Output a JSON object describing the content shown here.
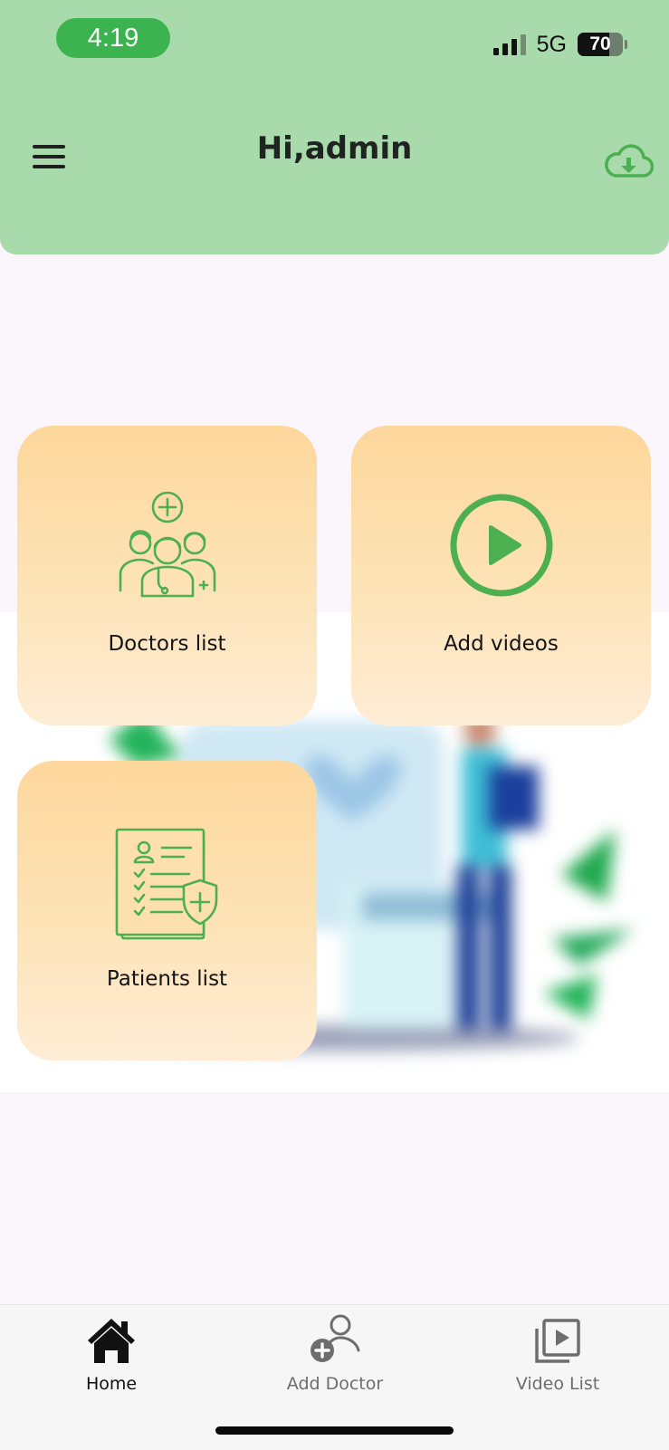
{
  "status_bar": {
    "time": "4:19",
    "network": "5G",
    "battery": "70",
    "battery_level": 0.7
  },
  "header": {
    "title": "Hi,admin",
    "menu_icon": "hamburger-menu-icon",
    "action_icon": "cloud-download-icon",
    "background": "#a8daab"
  },
  "cards": [
    {
      "label": "Doctors list",
      "icon": "doctors-group-icon"
    },
    {
      "label": "Add videos",
      "icon": "play-circle-icon"
    },
    {
      "label": "Patients list",
      "icon": "patient-records-icon"
    }
  ],
  "bottom_nav": {
    "items": [
      {
        "label": "Home",
        "icon": "home-icon",
        "active": true
      },
      {
        "label": "Add Doctor",
        "icon": "add-person-icon",
        "active": false
      },
      {
        "label": "Video List",
        "icon": "video-library-icon",
        "active": false
      }
    ]
  },
  "colors": {
    "accent_green": "#4caf50",
    "card_top": "#fdd79c",
    "card_bottom": "#feecd5"
  }
}
